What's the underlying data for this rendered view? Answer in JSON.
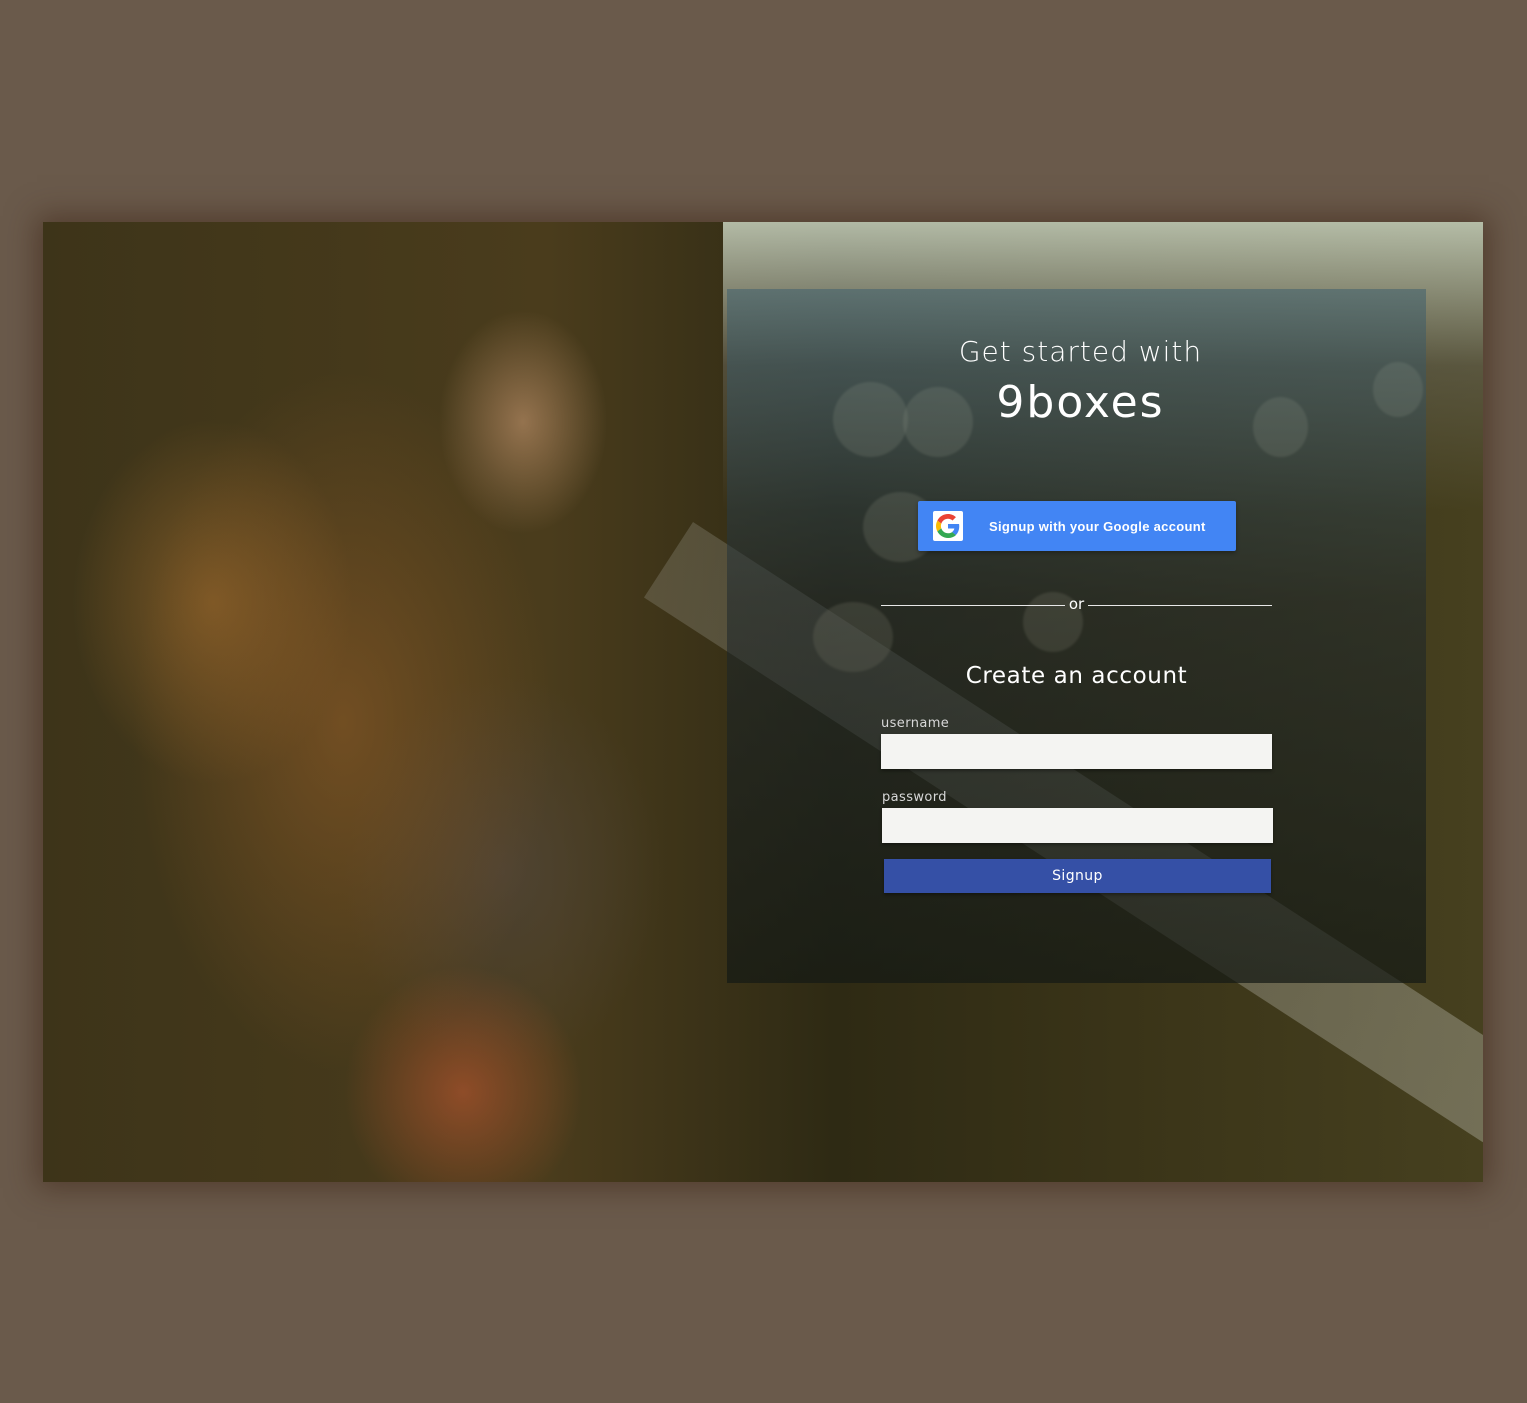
{
  "header": {
    "subtitle": "Get started with",
    "brand": "9boxes"
  },
  "google": {
    "label": "Signup with your Google account",
    "icon": "google-g-icon"
  },
  "divider": {
    "text": "or"
  },
  "form": {
    "title": "Create an account",
    "username_label": "username",
    "username_value": "",
    "password_label": "password",
    "password_value": "",
    "submit_label": "Signup"
  },
  "colors": {
    "page_background": "#6a5a4b",
    "google_button": "#4285f4",
    "signup_button": "#3550a6"
  }
}
